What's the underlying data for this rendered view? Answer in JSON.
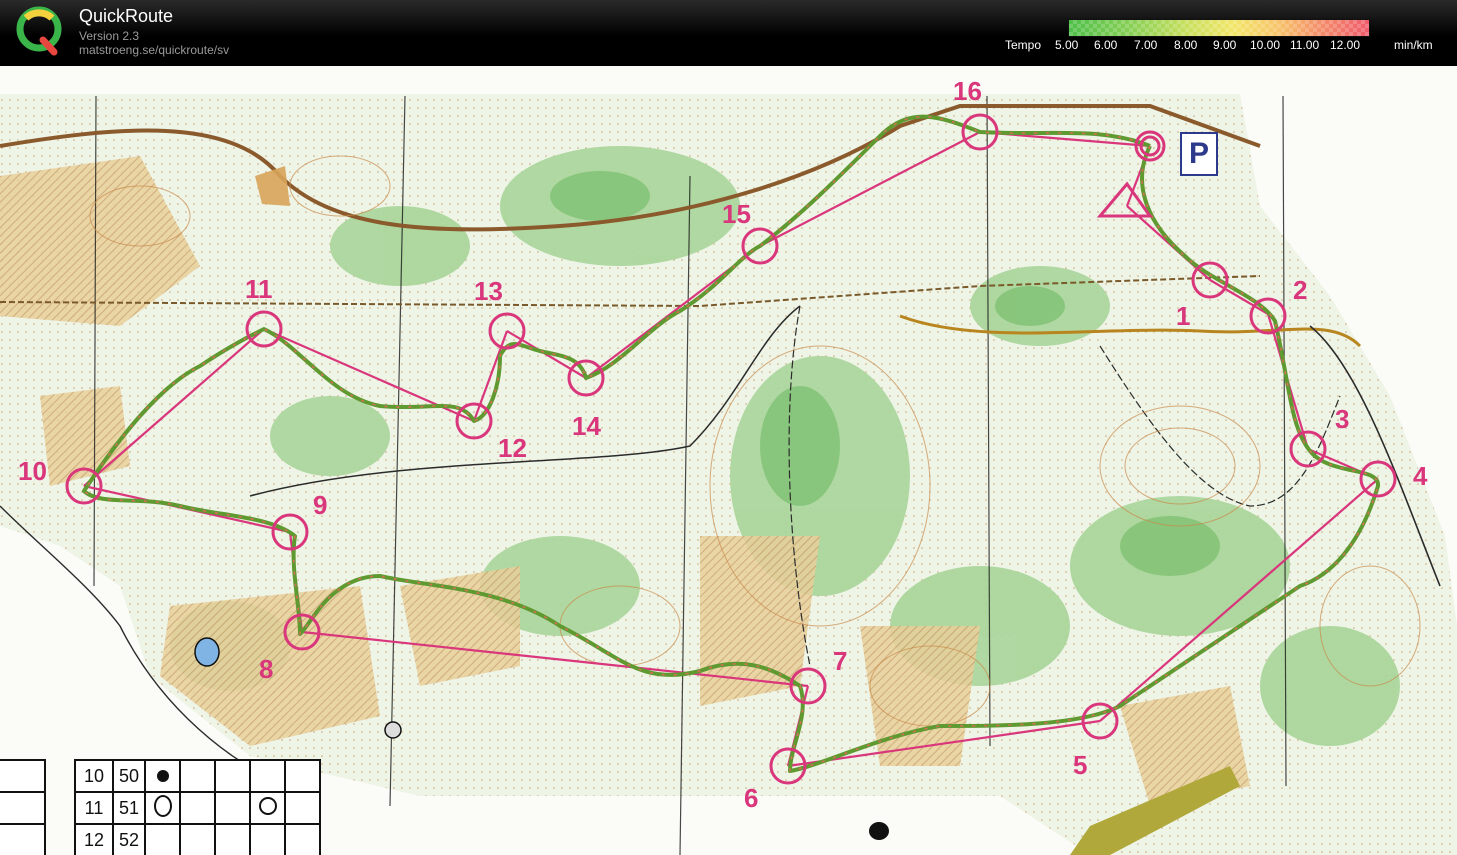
{
  "app": {
    "title": "QuickRoute",
    "version": "Version 2.3",
    "url": "matstroeng.se/quickroute/sv",
    "logo_letter": "Q"
  },
  "legend": {
    "label": "Tempo",
    "ticks": [
      "5.00",
      "6.00",
      "7.00",
      "8.00",
      "9.00",
      "10.00",
      "11.00",
      "12.00"
    ],
    "unit": "min/km",
    "colors": [
      "#4fc04a",
      "#86cf55",
      "#cbe05e",
      "#f3e66a",
      "#f7c36a",
      "#f48a6b",
      "#ef5b6c"
    ]
  },
  "map": {
    "parking_label": "P",
    "course_color": "#d9367c",
    "route_color": "#6aa83a",
    "controls": [
      "1",
      "2",
      "3",
      "4",
      "5",
      "6",
      "7",
      "8",
      "9",
      "10",
      "11",
      "12",
      "13",
      "14",
      "15",
      "16"
    ]
  },
  "description_table": {
    "rows": [
      {
        "num": "10",
        "code": "50"
      },
      {
        "num": "11",
        "code": "51"
      },
      {
        "num": "12",
        "code": "52"
      }
    ]
  }
}
